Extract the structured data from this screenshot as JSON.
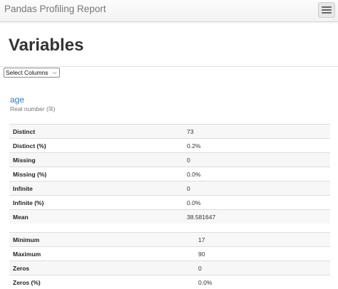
{
  "navbar": {
    "title": "Pandas Profiling Report"
  },
  "page": {
    "title": "Variables",
    "select_columns": "Select Columns"
  },
  "variable": {
    "name": "age",
    "type": "Real number (ℝ)"
  },
  "stats_table_1": [
    {
      "label": "Distinct",
      "value": "73"
    },
    {
      "label": "Distinct (%)",
      "value": "0.2%"
    },
    {
      "label": "Missing",
      "value": "0"
    },
    {
      "label": "Missing (%)",
      "value": "0.0%"
    },
    {
      "label": "Infinite",
      "value": "0"
    },
    {
      "label": "Infinite (%)",
      "value": "0.0%"
    },
    {
      "label": "Mean",
      "value": "38.581647"
    }
  ],
  "stats_table_2": [
    {
      "label": "Minimum",
      "value": "17"
    },
    {
      "label": "Maximum",
      "value": "90"
    },
    {
      "label": "Zeros",
      "value": "0"
    },
    {
      "label": "Zeros (%)",
      "value": "0.0%"
    }
  ],
  "colors": {
    "link": "#337ab7",
    "navbar_bg": "#f8f8f8"
  },
  "icons": {
    "menu": "hamburger-menu-icon"
  }
}
